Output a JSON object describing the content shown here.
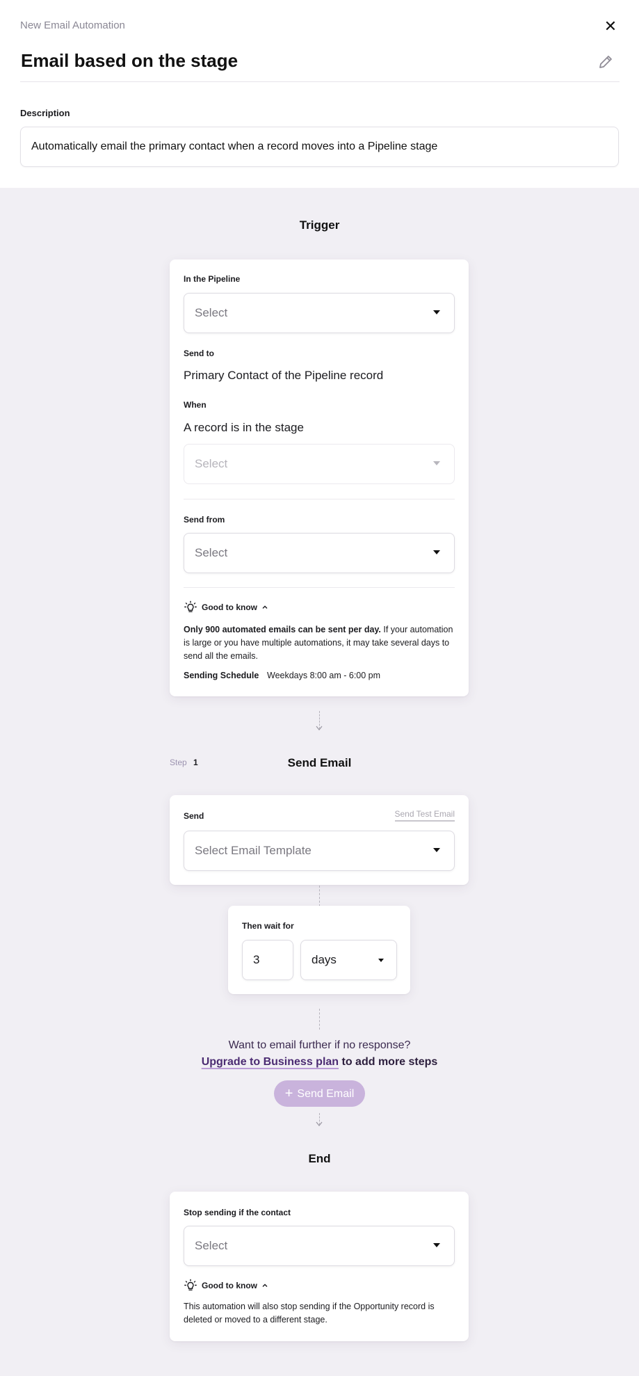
{
  "header": {
    "kicker": "New Email Automation",
    "title": "Email based on the stage",
    "close_icon": "close-icon",
    "edit_icon": "pencil-icon"
  },
  "description": {
    "label": "Description",
    "value": "Automatically email the primary contact when a record moves into a Pipeline stage"
  },
  "trigger": {
    "section_title": "Trigger",
    "pipeline_label": "In the Pipeline",
    "pipeline_placeholder": "Select",
    "send_to_label": "Send to",
    "send_to_value": "Primary Contact of the Pipeline record",
    "when_label": "When",
    "when_value": "A record is in the stage",
    "stage_placeholder": "Select",
    "send_from_label": "Send from",
    "send_from_placeholder": "Select",
    "good_to_know": "Good to know",
    "note_bold": "Only 900 automated emails can be sent per day.",
    "note_rest": " If your automation is large or you have multiple automations, it may take several days to send all the emails.",
    "schedule_label": "Sending Schedule",
    "schedule_value": "Weekdays 8:00 am - 6:00 pm"
  },
  "step": {
    "tag": "Step",
    "number": "1",
    "title": "Send Email",
    "send_label": "Send",
    "test_link": "Send Test Email",
    "template_placeholder": "Select Email Template"
  },
  "wait": {
    "label": "Then wait for",
    "amount": "3",
    "unit": "days"
  },
  "upgrade": {
    "question": "Want to email further if no response?",
    "link": "Upgrade to Business plan",
    "rest": " to add more steps",
    "button": "Send Email"
  },
  "end": {
    "section_title": "End",
    "stop_label": "Stop sending if the contact",
    "stop_placeholder": "Select",
    "good_to_know": "Good to know",
    "note": "This automation will also stop sending if the Opportunity record is deleted or moved to a different stage."
  },
  "colors": {
    "canvas": "#f1eff4",
    "accent_button": "#c9b3dc",
    "link": "#4b2b72"
  }
}
